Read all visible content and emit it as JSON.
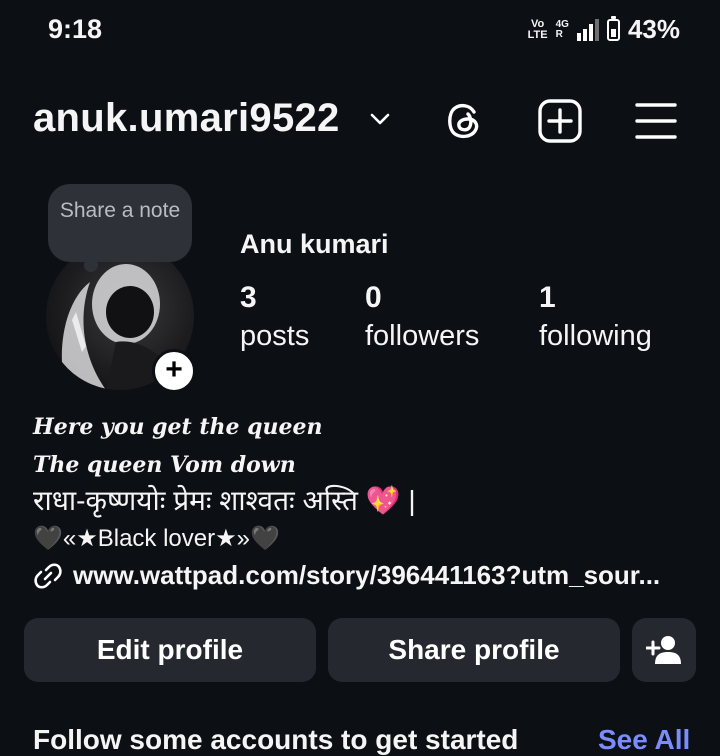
{
  "status_bar": {
    "time": "9:18",
    "volte_top": "Vo",
    "volte_bottom": "LTE",
    "network_top": "4G",
    "network_bottom": "R",
    "battery": "43%"
  },
  "header": {
    "username": "anuk.umari9522",
    "icons": [
      "chevron-down-icon",
      "threads-icon",
      "add-square-icon",
      "menu-icon"
    ]
  },
  "profile": {
    "note_placeholder": "Share a note",
    "display_name": "Anu kumari",
    "stats": [
      {
        "value": "3",
        "label": "posts"
      },
      {
        "value": "0",
        "label": "followers"
      },
      {
        "value": "1",
        "label": "following"
      }
    ]
  },
  "bio": {
    "line1": "Here you get the queen",
    "line2": "The queen Vom down",
    "line3": "राधा-कृष्णयोः प्रेमः शाश्वतः अस्ति 💖 |",
    "line4": "🖤«★Black lover★»🖤",
    "link": "www.wattpad.com/story/396441163?utm_sour..."
  },
  "actions": {
    "edit_profile": "Edit profile",
    "share_profile": "Share profile",
    "add_person_icon": "add-person-icon"
  },
  "suggestions": {
    "title": "Follow some accounts to get started",
    "see_all": "See All"
  },
  "colors": {
    "background": "#0c0f14",
    "button": "#25282e",
    "note": "#2e3138",
    "link_accent": "#7b8cff"
  }
}
